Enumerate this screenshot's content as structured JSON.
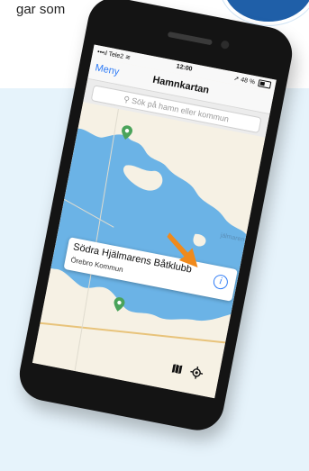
{
  "page": {
    "top_text_fragment": "gar som"
  },
  "status_bar": {
    "carrier": "Tele2",
    "time": "12:00",
    "battery": "48 %"
  },
  "nav": {
    "menu_label": "Meny",
    "title": "Hamnkartan"
  },
  "search": {
    "placeholder": "Sök på hamn eller kommun"
  },
  "map": {
    "label_lake_partial": "jälmaren",
    "callout": {
      "title": "Södra Hjälmarens Båtklubb",
      "subtitle": "Örebro Kommun"
    }
  },
  "icons": {
    "wifi": "wifi-icon",
    "location_arrow": "location-arrow-icon",
    "search": "search-icon",
    "pin": "map-pin-icon",
    "info": "info-icon",
    "map_mode": "map-icon",
    "locate": "locate-icon",
    "pointer": "arrow-pointer-icon"
  },
  "colors": {
    "accent": "#2f7cf6",
    "pin": "#4aa35a",
    "water": "#6bb3e6",
    "arrow": "#f08a1c",
    "badge": "#1f5fa8",
    "panel_bg": "#e6f3fb"
  }
}
